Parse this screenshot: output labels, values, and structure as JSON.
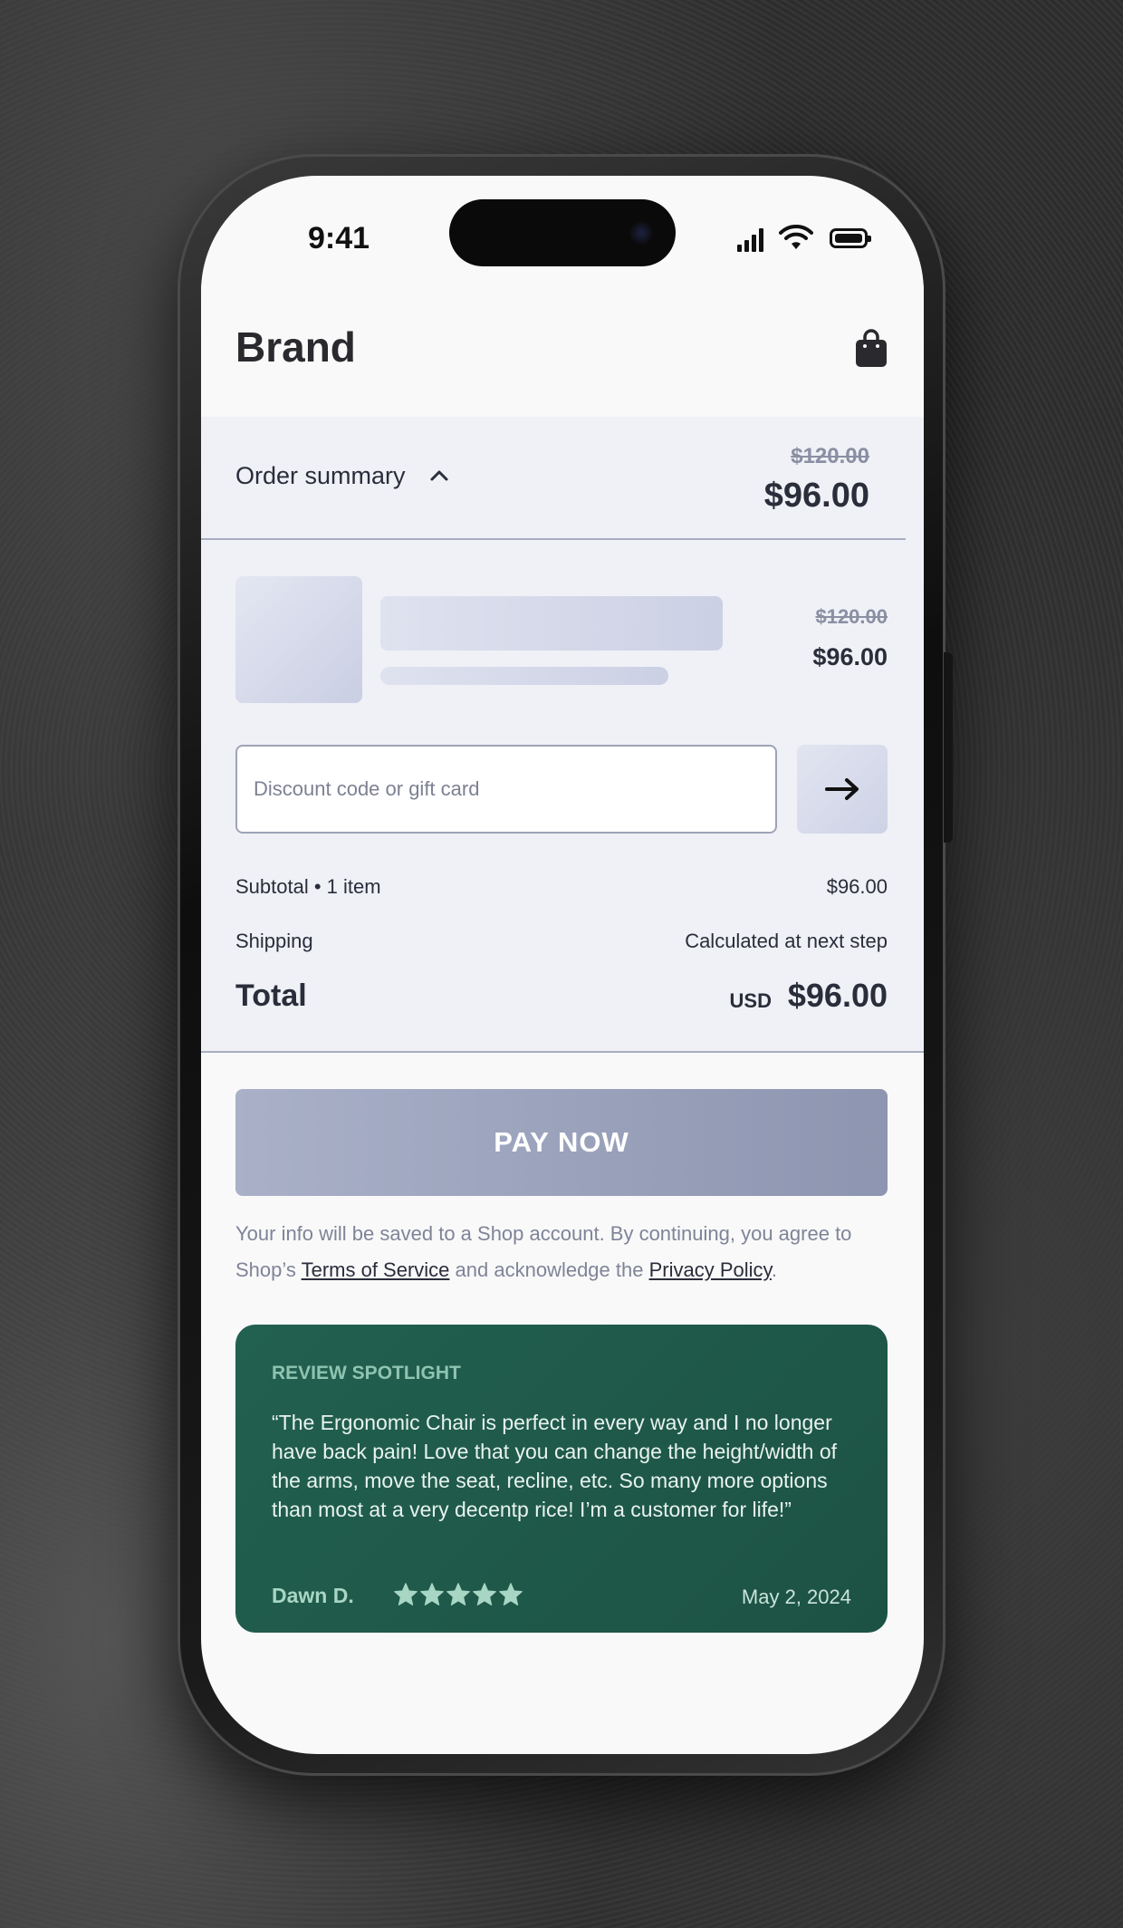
{
  "status_bar": {
    "time": "9:41"
  },
  "header": {
    "brand": "Brand"
  },
  "order_summary": {
    "label": "Order summary",
    "original_price": "$120.00",
    "price": "$96.00"
  },
  "line_item": {
    "original_price": "$120.00",
    "price": "$96.00"
  },
  "discount": {
    "placeholder": "Discount code or gift card",
    "value": ""
  },
  "totals": {
    "subtotal_label": "Subtotal • 1 item",
    "subtotal_value": "$96.00",
    "shipping_label": "Shipping",
    "shipping_value": "Calculated at next step",
    "total_label": "Total",
    "currency": "USD",
    "total_value": "$96.00"
  },
  "pay_button": {
    "label": "PAY NOW"
  },
  "legal": {
    "text_1": "Your info will be saved to a Shop account. By continuing, you agree to Shop’s ",
    "terms_link": "Terms of Service",
    "text_2": " and acknowledge the ",
    "privacy_link": "Privacy Policy",
    "text_3": "."
  },
  "review": {
    "heading": "REVIEW SPOTLIGHT",
    "text": "“The Ergonomic Chair is perfect in every way and I no longer have back pain! Love that you can change the height/width of the arms, move the seat, recline, etc. So many more options than most at a very decentp rice! I’m a customer for life!”",
    "reviewer": "Dawn D.",
    "rating": 5,
    "rating_max": 5,
    "date": "May 2, 2024"
  },
  "colors": {
    "review_bg": "#1f5a4a",
    "pay_button": "#9aa1bc",
    "summary_bg": "#eff1f6"
  }
}
